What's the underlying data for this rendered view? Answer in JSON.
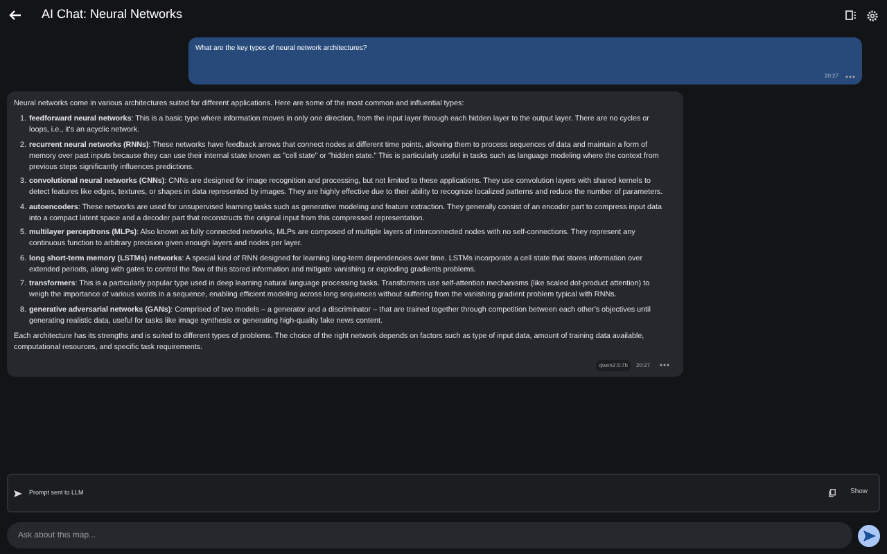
{
  "header": {
    "title": "AI Chat: Neural Networks"
  },
  "messages": [
    {
      "kind": "user",
      "text": "What are the key types of neural network architectures?",
      "time": "20:27"
    },
    {
      "kind": "assistant",
      "intro": "Neural networks come in various architectures suited for different applications. Here are some of the most common and influential types:",
      "items": [
        {
          "number": "1.",
          "text": "**feedforward neural networks**: This is a basic type where information moves in only one direction, from the input layer through each hidden layer to the output layer. There are no cycles or loops, i.e., it's an acyclic network."
        },
        {
          "number": "2.",
          "text": "**recurrent neural networks (RNNs)**: These networks have feedback arrows that connect nodes at different time points, allowing them to process sequences of data and maintain a form of memory over past inputs because they can use their internal state known as \"cell state\" or \"hidden state.\" This is particularly useful in tasks such as language modeling where the context from previous steps significantly influences predictions."
        },
        {
          "number": "3.",
          "text": "**convolutional neural networks (CNNs)**: CNNs are designed for image recognition and processing, but not limited to these applications. They use convolution layers with shared kernels to detect features like edges, textures, or shapes in data represented by images. They are highly effective due to their ability to recognize localized patterns and reduce the number of parameters."
        },
        {
          "number": "4.",
          "text": "**autoencoders**: These networks are used for unsupervised learning tasks such as generative modeling and feature extraction. They generally consist of an encoder part to compress input data into a compact latent space and a decoder part that reconstructs the original input from this compressed representation."
        },
        {
          "number": "5.",
          "text": "**multilayer perceptrons (MLPs)**: Also known as fully connected networks, MLPs are composed of multiple layers of interconnected nodes with no self-connections. They represent any continuous function to arbitrary precision given enough layers and nodes per layer."
        },
        {
          "number": "6.",
          "text": "**long short-term memory (LSTMs) networks**: A special kind of RNN designed for learning long-term dependencies over time. LSTMs incorporate a cell state that stores information over extended periods, along with gates to control the flow of this stored information and mitigate vanishing or exploding gradients problems."
        },
        {
          "number": "7.",
          "text": "**transformers**: This is a particularly popular type used in deep learning natural language processing tasks. Transformers use self-attention mechanisms (like scaled dot-product attention) to weigh the importance of various words in a sequence, enabling efficient modeling across long sequences without suffering from the vanishing gradient problem typical with RNNs."
        },
        {
          "number": "8.",
          "text": "**generative adversarial networks (GANs)**: Comprised of two models – a generator and a discriminator – that are trained together through competition between each other's objectives until generating realistic data, useful for tasks like image synthesis or generating high-quality fake news content."
        }
      ],
      "outro": "Each architecture has its strengths and is suited to different types of problems. The choice of the right network depends on factors such as type of input data, amount of training data available, computational resources, and specific task requirements.",
      "model": "qwen2.5:7b",
      "time": "20:27"
    }
  ],
  "prompt_bar": {
    "label": "Prompt sent to LLM",
    "action": "Show"
  },
  "composer": {
    "placeholder": "Ask about this map..."
  }
}
